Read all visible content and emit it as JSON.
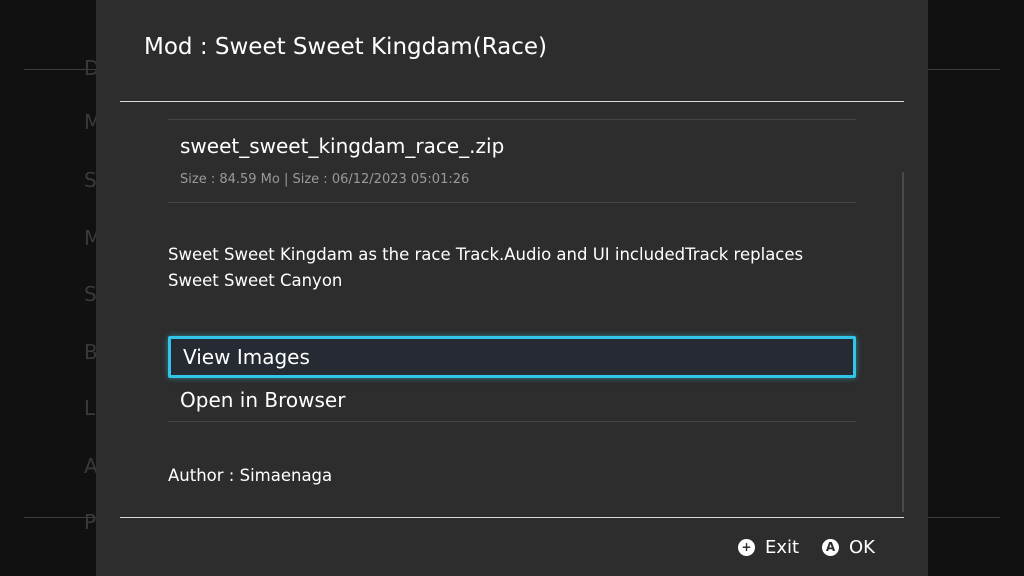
{
  "background_list": {
    "items": [
      "D",
      "M",
      "S",
      "M",
      "S",
      "B",
      "L",
      "A",
      "P"
    ]
  },
  "dialog": {
    "title": "Mod : Sweet Sweet Kingdam(Race)",
    "file": {
      "name": "sweet_sweet_kingdam_race_.zip",
      "meta": "Size : 84.59 Mo | Size : 06/12/2023 05:01:26"
    },
    "description": "Sweet Sweet Kingdam as the race Track.Audio and UI includedTrack replaces Sweet Sweet Canyon",
    "menu": [
      {
        "label": "View Images",
        "selected": true
      },
      {
        "label": "Open in Browser",
        "selected": false
      }
    ],
    "author": "Author : Simaenaga"
  },
  "footer": {
    "exit_label": "Exit",
    "ok_label": "OK",
    "exit_glyph": "+",
    "ok_glyph": "A"
  },
  "colors": {
    "dialog_bg": "#2d2d2d",
    "backdrop": "#111111",
    "selection_border": "#31c6e8",
    "text": "#ffffff",
    "muted_text": "#9a9a9a"
  },
  "icons": {
    "exit": "plus-circle-icon",
    "ok": "a-button-icon"
  }
}
